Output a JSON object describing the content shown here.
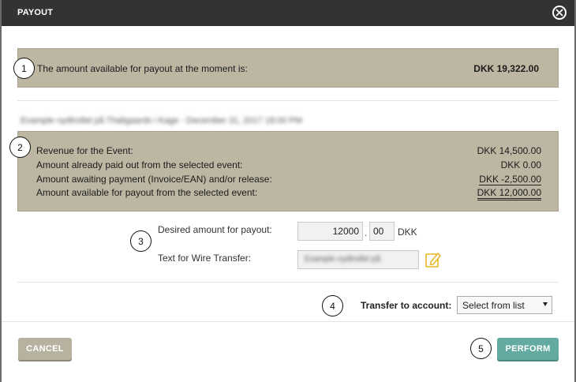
{
  "dialog": {
    "title": "PAYOUT"
  },
  "available": {
    "label": "The amount available for payout at the moment is:",
    "amount": "DKK 19,322.00"
  },
  "event": {
    "title": "Example nydtrollet på Thaligaards i Kage - December 31, 2017 18:00 PM",
    "rows": [
      {
        "label": "Revenue for the Event:",
        "value": "DKK 14,500.00"
      },
      {
        "label": "Amount already paid out from the selected event:",
        "value": "DKK 0.00"
      },
      {
        "label": "Amount awaiting payment (Invoice/EAN) and/or release:",
        "value": "DKK -2,500.00"
      },
      {
        "label": "Amount available for payout from the selected event:",
        "value": "DKK 12,000.00"
      }
    ]
  },
  "payout_form": {
    "desired_label": "Desired amount for payout:",
    "amount_whole": "12000",
    "separator": ".",
    "amount_decimal": "00",
    "currency": "DKK",
    "wire_label": "Text for Wire Transfer:",
    "wire_text": "Example nydtrollet på"
  },
  "transfer": {
    "label": "Transfer to account:",
    "selected": "Select from list"
  },
  "footer": {
    "cancel_label": "CANCEL",
    "perform_label": "PERFORM"
  },
  "markers": [
    "1",
    "2",
    "3",
    "4",
    "5"
  ],
  "icons": {
    "close": "close-circle-icon",
    "edit": "edit-pencil-icon"
  },
  "colors": {
    "panel": "#bcb6a2",
    "cancel": "#b7b29f",
    "perform": "#63aaa0",
    "edit_icon": "#e8b520"
  }
}
